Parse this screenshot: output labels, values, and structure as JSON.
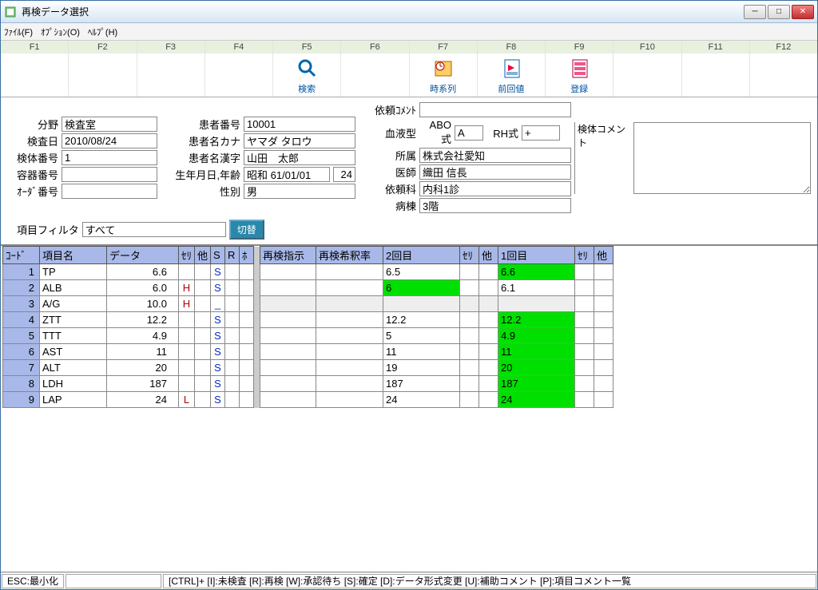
{
  "window": {
    "title": "再検データ選択"
  },
  "menu": {
    "file": "ﾌｧｲﾙ(F)",
    "option": "ｵﾌﾟｼｮﾝ(O)",
    "help": "ﾍﾙﾌﾟ(H)"
  },
  "fkeys": [
    {
      "key": "F1",
      "caption": "",
      "icon": ""
    },
    {
      "key": "F2",
      "caption": "",
      "icon": ""
    },
    {
      "key": "F3",
      "caption": "",
      "icon": ""
    },
    {
      "key": "F4",
      "caption": "",
      "icon": ""
    },
    {
      "key": "F5",
      "caption": "検索",
      "icon": "search"
    },
    {
      "key": "F6",
      "caption": "",
      "icon": ""
    },
    {
      "key": "F7",
      "caption": "時系列",
      "icon": "clock"
    },
    {
      "key": "F8",
      "caption": "前回値",
      "icon": "prev"
    },
    {
      "key": "F9",
      "caption": "登録",
      "icon": "register"
    },
    {
      "key": "F10",
      "caption": "",
      "icon": ""
    },
    {
      "key": "F11",
      "caption": "",
      "icon": ""
    },
    {
      "key": "F12",
      "caption": "",
      "icon": ""
    }
  ],
  "form": {
    "field_label": "分野",
    "field_value": "検査室",
    "exam_date_label": "検査日",
    "exam_date_value": "2010/08/24",
    "specimen_no_label": "検体番号",
    "specimen_no_value": "1",
    "container_no_label": "容器番号",
    "container_no_value": "",
    "order_no_label": "ｵｰﾀﾞ番号",
    "order_no_value": "",
    "patient_no_label": "患者番号",
    "patient_no_value": "10001",
    "patient_kana_label": "患者名カナ",
    "patient_kana_value": "ヤマダ タロウ",
    "patient_kanji_label": "患者名漢字",
    "patient_kanji_value": "山田　太郎",
    "dob_age_label": "生年月日,年齢",
    "dob_value": "昭和 61/01/01",
    "age_value": "24",
    "sex_label": "性別",
    "sex_value": "男",
    "req_comment_label": "依頼ｺﾒﾝﾄ",
    "req_comment_value": "",
    "blood_label": "血液型",
    "abo_label": "ABO式",
    "abo_value": "A",
    "rh_label": "RH式",
    "rh_value": "+",
    "affil_label": "所属",
    "affil_value": "株式会社愛知",
    "doctor_label": "医師",
    "doctor_value": "織田 信長",
    "dept_label": "依頼科",
    "dept_value": "内科1診",
    "ward_label": "病棟",
    "ward_value": "3階",
    "spec_comment_label": "検体コメント"
  },
  "filter": {
    "label": "項目フィルタ",
    "value": "すべて",
    "toggle": "切替"
  },
  "table": {
    "headers": {
      "code": "ｺｰﾄﾞ",
      "name": "項目名",
      "data": "データ",
      "seri": "ｾﾘ",
      "other": "他",
      "S": "S",
      "R": "R",
      "ho": "ﾎ",
      "reexam_instr": "再検指示",
      "reexam_dilution": "再検希釈率",
      "second": "2回目",
      "first": "1回目"
    },
    "rows": [
      {
        "code": "1",
        "name": "TP",
        "data": "6.6",
        "flag": "",
        "s": "S",
        "second": "6.5",
        "second_green": false,
        "first": "6.6",
        "first_green": true,
        "grey": false
      },
      {
        "code": "2",
        "name": "ALB",
        "data": "6.0",
        "flag": "H",
        "s": "S",
        "second": "6",
        "second_green": true,
        "first": "6.1",
        "first_green": false,
        "grey": false
      },
      {
        "code": "3",
        "name": "A/G",
        "data": "10.0",
        "flag": "H",
        "s": "_",
        "second": "",
        "second_green": false,
        "first": "",
        "first_green": false,
        "grey": true
      },
      {
        "code": "4",
        "name": "ZTT",
        "data": "12.2",
        "flag": "",
        "s": "S",
        "second": "12.2",
        "second_green": false,
        "first": "12.2",
        "first_green": true,
        "grey": false
      },
      {
        "code": "5",
        "name": "TTT",
        "data": "4.9",
        "flag": "",
        "s": "S",
        "second": "5",
        "second_green": false,
        "first": "4.9",
        "first_green": true,
        "grey": false
      },
      {
        "code": "6",
        "name": "AST",
        "data": "11",
        "flag": "",
        "s": "S",
        "second": "11",
        "second_green": false,
        "first": "11",
        "first_green": true,
        "grey": false
      },
      {
        "code": "7",
        "name": "ALT",
        "data": "20",
        "flag": "",
        "s": "S",
        "second": "19",
        "second_green": false,
        "first": "20",
        "first_green": true,
        "grey": false
      },
      {
        "code": "8",
        "name": "LDH",
        "data": "187",
        "flag": "",
        "s": "S",
        "second": "187",
        "second_green": false,
        "first": "187",
        "first_green": true,
        "grey": false
      },
      {
        "code": "9",
        "name": "LAP",
        "data": "24",
        "flag": "L",
        "s": "S",
        "second": "24",
        "second_green": false,
        "first": "24",
        "first_green": true,
        "grey": false
      }
    ]
  },
  "status": {
    "esc": "ESC:最小化",
    "hints": "[CTRL]+ [I]:未検査  [R]:再検  [W]:承認待ち  [S]:確定 [D]:データ形式変更  [U]:補助コメント  [P]:項目コメント一覧"
  }
}
